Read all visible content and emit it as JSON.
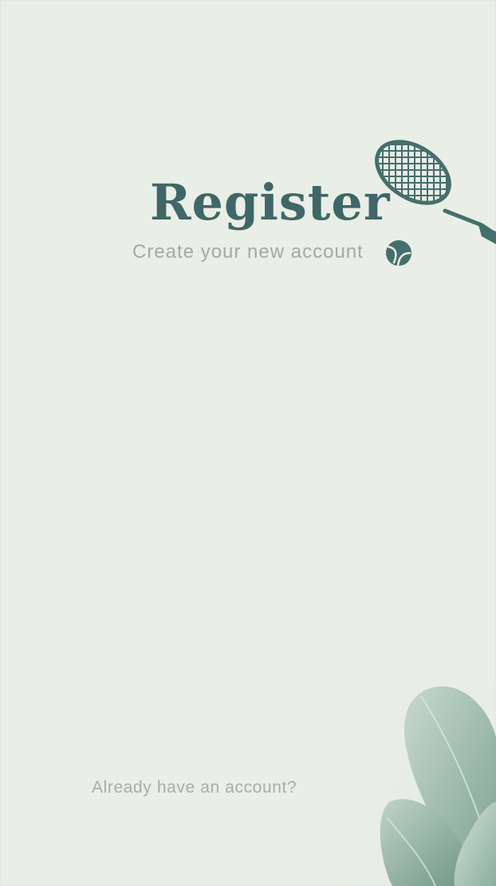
{
  "header": {
    "title": "Register",
    "subtitle": "Create your new account"
  },
  "footer": {
    "login_prompt": "Already have an account?"
  },
  "icons": {
    "racket": "tennis-racket-icon",
    "ball": "tennis-ball-icon",
    "decoration": "leaves-decoration"
  },
  "colors": {
    "background": "#e9eee7",
    "title": "#3f6767",
    "subtitle": "#a3aaa6",
    "muted_text": "#a6aeaa",
    "accent": "#456f6c",
    "leaf_light": "#b7cdc1",
    "leaf_dark": "#7fa394"
  }
}
